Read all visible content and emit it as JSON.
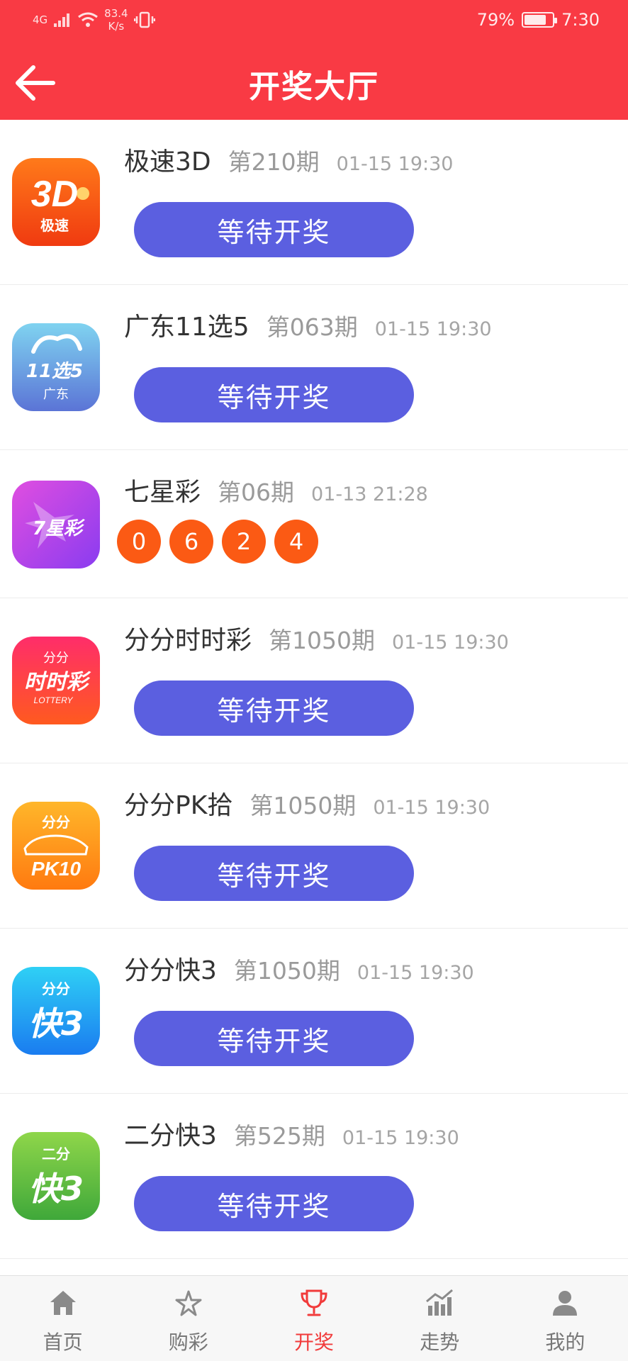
{
  "status_bar": {
    "network": "4G",
    "speed_value": "83.4",
    "speed_unit": "K/s",
    "battery": "79%",
    "battery_level": 0.79,
    "time": "7:30"
  },
  "header": {
    "title": "开奖大厅",
    "back_icon": "arrow-left-icon"
  },
  "lotteries": [
    {
      "name": "极速3D",
      "issue": "第210期",
      "time": "01-15 19:30",
      "status": "等待开奖",
      "logo_text": "3D",
      "logo_sub": "极速"
    },
    {
      "name": "广东11选5",
      "issue": "第063期",
      "time": "01-15 19:30",
      "status": "等待开奖",
      "logo_text": "11选5",
      "logo_sub": "广东"
    },
    {
      "name": "七星彩",
      "issue": "第06期",
      "time": "01-13 21:28",
      "balls": [
        "0",
        "6",
        "2",
        "4"
      ],
      "logo_text": "7星彩"
    },
    {
      "name": "分分时时彩",
      "issue": "第1050期",
      "time": "01-15 19:30",
      "status": "等待开奖",
      "logo_text": "时时彩",
      "logo_top": "分分",
      "logo_sub": "LOTTERY"
    },
    {
      "name": "分分PK拾",
      "issue": "第1050期",
      "time": "01-15 19:30",
      "status": "等待开奖",
      "logo_top": "分分",
      "logo_text": "PK10"
    },
    {
      "name": "分分快3",
      "issue": "第1050期",
      "time": "01-15 19:30",
      "status": "等待开奖",
      "logo_top": "分分",
      "logo_text": "快3"
    },
    {
      "name": "二分快3",
      "issue": "第525期",
      "time": "01-15 19:30",
      "status": "等待开奖",
      "logo_top": "二分",
      "logo_text": "快3"
    }
  ],
  "tabbar": [
    {
      "label": "首页",
      "icon": "home-icon",
      "active": false
    },
    {
      "label": "购彩",
      "icon": "star-burst-icon",
      "active": false
    },
    {
      "label": "开奖",
      "icon": "trophy-icon",
      "active": true
    },
    {
      "label": "走势",
      "icon": "trend-chart-icon",
      "active": false
    },
    {
      "label": "我的",
      "icon": "user-icon",
      "active": false
    }
  ],
  "colors": {
    "header_red": "#f93a44",
    "button_blue": "#5b5fe0",
    "ball_orange": "#fb5a14",
    "active_tab": "#f13b3b"
  }
}
